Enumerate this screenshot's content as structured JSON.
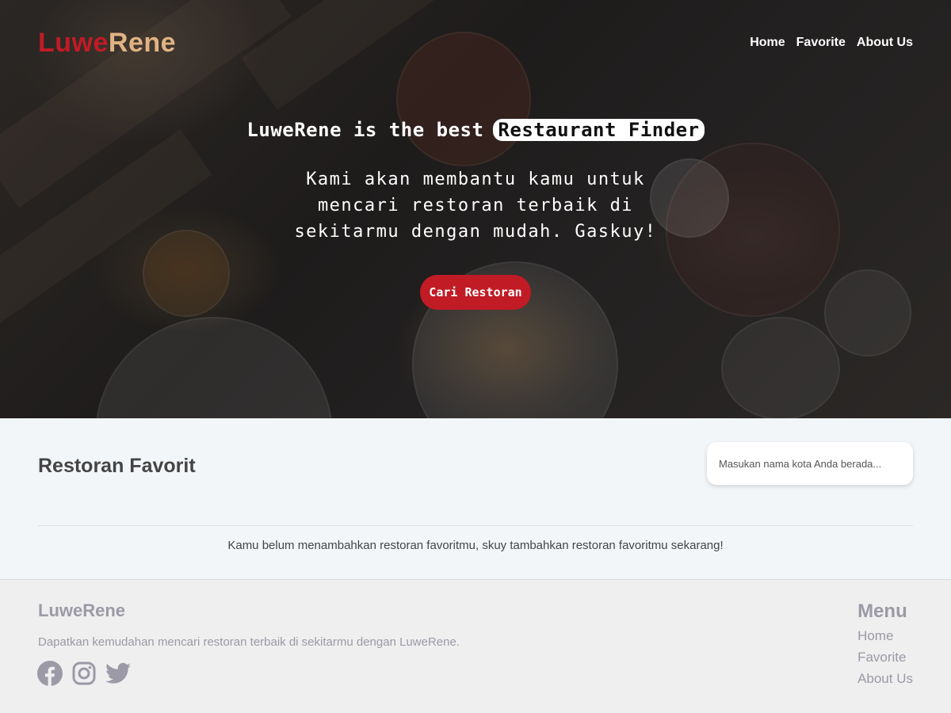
{
  "header": {
    "brand_part1": "Luwe",
    "brand_part2": "Rene",
    "nav": [
      {
        "label": "Home"
      },
      {
        "label": "Favorite"
      },
      {
        "label": "About Us"
      }
    ]
  },
  "hero": {
    "title_prefix": "LuweRene is the best",
    "title_highlight": "Restaurant Finder",
    "subtitle": "Kami akan membantu kamu untuk mencari restoran terbaik di sekitarmu dengan mudah. Gaskuy!",
    "cta_label": "Cari Restoran"
  },
  "main": {
    "title": "Restoran Favorit",
    "search_placeholder": "Masukan nama kota Anda berada...",
    "empty_message": "Kamu belum menambahkan restoran favoritmu, skuy tambahkan restoran favoritmu sekarang!"
  },
  "footer": {
    "brand": "LuweRene",
    "description": "Dapatkan kemudahan mencari restoran terbaik di sekitarmu dengan LuweRene.",
    "socials": [
      "facebook-icon",
      "instagram-icon",
      "twitter-icon"
    ],
    "menu_title": "Menu",
    "menu": [
      {
        "label": "Home"
      },
      {
        "label": "Favorite"
      },
      {
        "label": "About Us"
      }
    ]
  },
  "colors": {
    "primary_red": "#c11b26",
    "brand_accent": "#e0b382",
    "footer_text": "#9b9aa6"
  }
}
